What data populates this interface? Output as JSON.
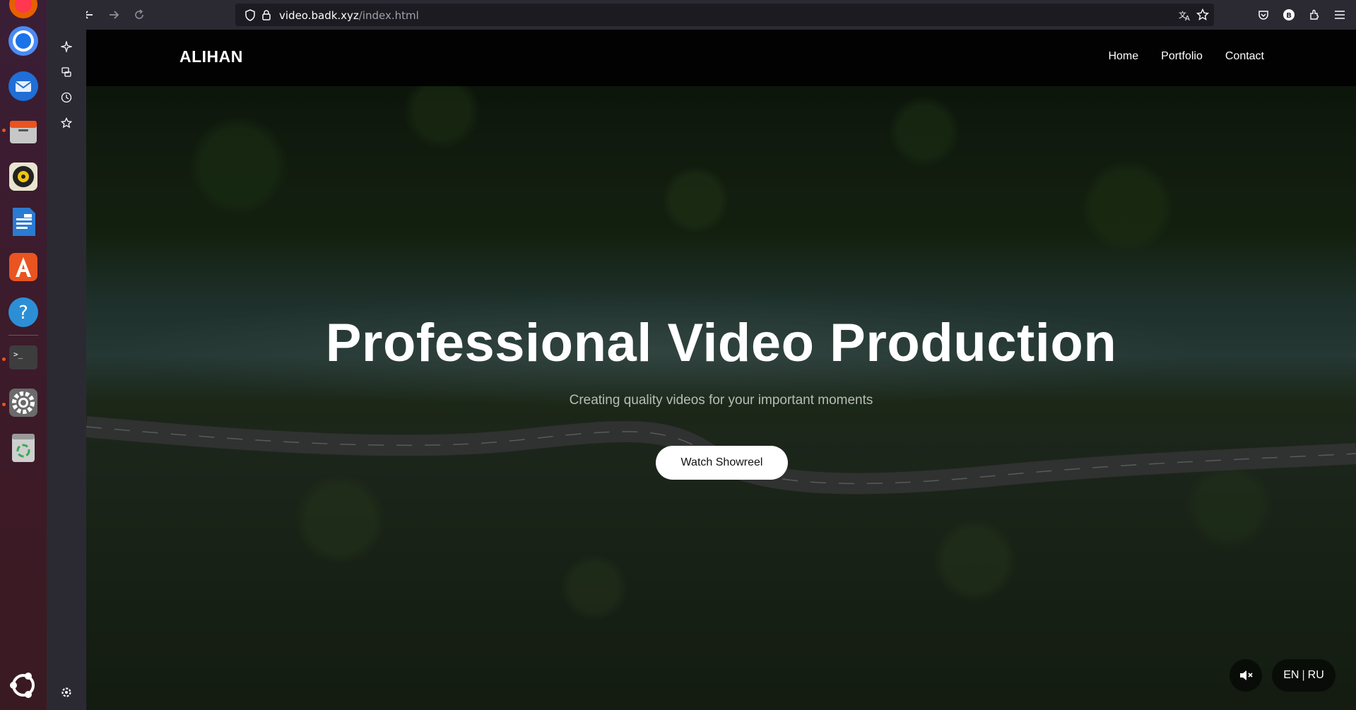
{
  "browser": {
    "url_host": "video.badk.xyz",
    "url_path": "/index.html"
  },
  "dock": {
    "items": [
      "firefox-icon",
      "chromium-icon",
      "thunderbird-icon",
      "files-icon",
      "rhythmbox-icon",
      "writer-icon",
      "app-center-icon",
      "help-icon",
      "terminal-icon",
      "settings-icon",
      "trash-icon",
      "ubuntu-logo-icon"
    ]
  },
  "site": {
    "logo": "ALIHAN",
    "nav": [
      "Home",
      "Portfolio",
      "Contact"
    ],
    "hero_title": "Professional Video Production",
    "hero_subtitle": "Creating quality videos for your important moments",
    "cta": "Watch Showreel",
    "lang_en": "EN",
    "lang_sep": "|",
    "lang_ru": "RU"
  }
}
